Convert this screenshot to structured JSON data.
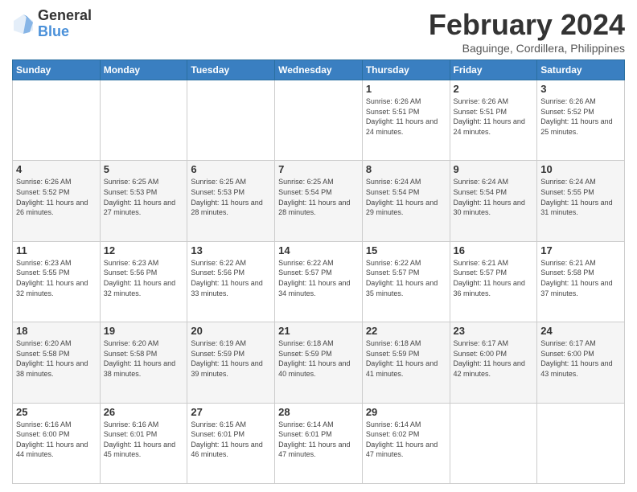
{
  "logo": {
    "general": "General",
    "blue": "Blue"
  },
  "header": {
    "title": "February 2024",
    "location": "Baguinge, Cordillera, Philippines"
  },
  "weekdays": [
    "Sunday",
    "Monday",
    "Tuesday",
    "Wednesday",
    "Thursday",
    "Friday",
    "Saturday"
  ],
  "weeks": [
    [
      {
        "day": "",
        "info": ""
      },
      {
        "day": "",
        "info": ""
      },
      {
        "day": "",
        "info": ""
      },
      {
        "day": "",
        "info": ""
      },
      {
        "day": "1",
        "info": "Sunrise: 6:26 AM\nSunset: 5:51 PM\nDaylight: 11 hours and 24 minutes."
      },
      {
        "day": "2",
        "info": "Sunrise: 6:26 AM\nSunset: 5:51 PM\nDaylight: 11 hours and 24 minutes."
      },
      {
        "day": "3",
        "info": "Sunrise: 6:26 AM\nSunset: 5:52 PM\nDaylight: 11 hours and 25 minutes."
      }
    ],
    [
      {
        "day": "4",
        "info": "Sunrise: 6:26 AM\nSunset: 5:52 PM\nDaylight: 11 hours and 26 minutes."
      },
      {
        "day": "5",
        "info": "Sunrise: 6:25 AM\nSunset: 5:53 PM\nDaylight: 11 hours and 27 minutes."
      },
      {
        "day": "6",
        "info": "Sunrise: 6:25 AM\nSunset: 5:53 PM\nDaylight: 11 hours and 28 minutes."
      },
      {
        "day": "7",
        "info": "Sunrise: 6:25 AM\nSunset: 5:54 PM\nDaylight: 11 hours and 28 minutes."
      },
      {
        "day": "8",
        "info": "Sunrise: 6:24 AM\nSunset: 5:54 PM\nDaylight: 11 hours and 29 minutes."
      },
      {
        "day": "9",
        "info": "Sunrise: 6:24 AM\nSunset: 5:54 PM\nDaylight: 11 hours and 30 minutes."
      },
      {
        "day": "10",
        "info": "Sunrise: 6:24 AM\nSunset: 5:55 PM\nDaylight: 11 hours and 31 minutes."
      }
    ],
    [
      {
        "day": "11",
        "info": "Sunrise: 6:23 AM\nSunset: 5:55 PM\nDaylight: 11 hours and 32 minutes."
      },
      {
        "day": "12",
        "info": "Sunrise: 6:23 AM\nSunset: 5:56 PM\nDaylight: 11 hours and 32 minutes."
      },
      {
        "day": "13",
        "info": "Sunrise: 6:22 AM\nSunset: 5:56 PM\nDaylight: 11 hours and 33 minutes."
      },
      {
        "day": "14",
        "info": "Sunrise: 6:22 AM\nSunset: 5:57 PM\nDaylight: 11 hours and 34 minutes."
      },
      {
        "day": "15",
        "info": "Sunrise: 6:22 AM\nSunset: 5:57 PM\nDaylight: 11 hours and 35 minutes."
      },
      {
        "day": "16",
        "info": "Sunrise: 6:21 AM\nSunset: 5:57 PM\nDaylight: 11 hours and 36 minutes."
      },
      {
        "day": "17",
        "info": "Sunrise: 6:21 AM\nSunset: 5:58 PM\nDaylight: 11 hours and 37 minutes."
      }
    ],
    [
      {
        "day": "18",
        "info": "Sunrise: 6:20 AM\nSunset: 5:58 PM\nDaylight: 11 hours and 38 minutes."
      },
      {
        "day": "19",
        "info": "Sunrise: 6:20 AM\nSunset: 5:58 PM\nDaylight: 11 hours and 38 minutes."
      },
      {
        "day": "20",
        "info": "Sunrise: 6:19 AM\nSunset: 5:59 PM\nDaylight: 11 hours and 39 minutes."
      },
      {
        "day": "21",
        "info": "Sunrise: 6:18 AM\nSunset: 5:59 PM\nDaylight: 11 hours and 40 minutes."
      },
      {
        "day": "22",
        "info": "Sunrise: 6:18 AM\nSunset: 5:59 PM\nDaylight: 11 hours and 41 minutes."
      },
      {
        "day": "23",
        "info": "Sunrise: 6:17 AM\nSunset: 6:00 PM\nDaylight: 11 hours and 42 minutes."
      },
      {
        "day": "24",
        "info": "Sunrise: 6:17 AM\nSunset: 6:00 PM\nDaylight: 11 hours and 43 minutes."
      }
    ],
    [
      {
        "day": "25",
        "info": "Sunrise: 6:16 AM\nSunset: 6:00 PM\nDaylight: 11 hours and 44 minutes."
      },
      {
        "day": "26",
        "info": "Sunrise: 6:16 AM\nSunset: 6:01 PM\nDaylight: 11 hours and 45 minutes."
      },
      {
        "day": "27",
        "info": "Sunrise: 6:15 AM\nSunset: 6:01 PM\nDaylight: 11 hours and 46 minutes."
      },
      {
        "day": "28",
        "info": "Sunrise: 6:14 AM\nSunset: 6:01 PM\nDaylight: 11 hours and 47 minutes."
      },
      {
        "day": "29",
        "info": "Sunrise: 6:14 AM\nSunset: 6:02 PM\nDaylight: 11 hours and 47 minutes."
      },
      {
        "day": "",
        "info": ""
      },
      {
        "day": "",
        "info": ""
      }
    ]
  ]
}
